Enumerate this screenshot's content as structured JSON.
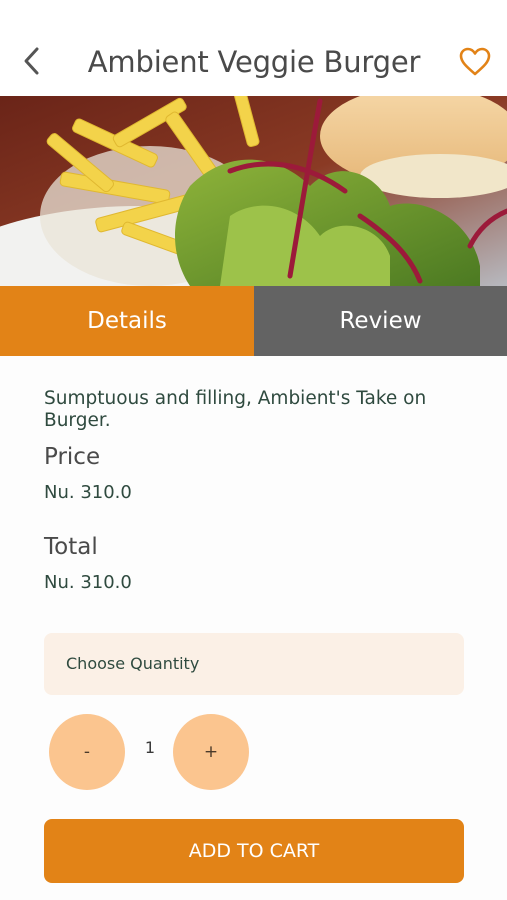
{
  "header": {
    "title": "Ambient Veggie Burger",
    "back_icon": "chevron-left-icon",
    "favorite_icon": "heart-outline-icon"
  },
  "hero": {
    "image": "veggie-burger-with-fries-and-salad-photo"
  },
  "tabs": [
    {
      "label": "Details",
      "active": true
    },
    {
      "label": "Review",
      "active": false
    }
  ],
  "details": {
    "description": "Sumptuous and filling, Ambient's Take on Burger.",
    "price_label": "Price",
    "price_value": "Nu. 310.0",
    "total_label": "Total",
    "total_value": "Nu. 310.0"
  },
  "quantity": {
    "label": "Choose Quantity",
    "decrement_label": "-",
    "increment_label": "+",
    "value": "1"
  },
  "cart": {
    "button_label": "ADD TO CART"
  },
  "colors": {
    "accent": "#e28317",
    "tab_inactive": "#636363",
    "stepper": "#fbc58f",
    "quantity_box": "#fbf0e6"
  }
}
